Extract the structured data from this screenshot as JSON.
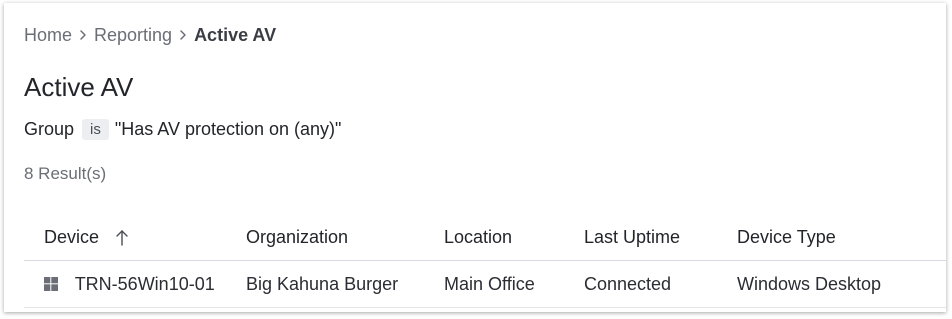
{
  "breadcrumb": {
    "items": [
      "Home",
      "Reporting"
    ],
    "current": "Active AV"
  },
  "page": {
    "title": "Active AV"
  },
  "filter": {
    "field": "Group",
    "operator": "is",
    "value": "\"Has AV protection on (any)\""
  },
  "results": {
    "count_label": "8 Result(s)"
  },
  "table": {
    "columns": [
      "Device",
      "Organization",
      "Location",
      "Last Uptime",
      "Device Type"
    ],
    "sorted_column": "Device",
    "sort_direction": "ascending",
    "rows": [
      {
        "icon": "windows-icon",
        "device": "TRN-56Win10-01",
        "organization": "Big Kahuna Burger",
        "location": "Main Office",
        "last_uptime": "Connected",
        "device_type": "Windows Desktop"
      }
    ]
  },
  "colors": {
    "text_primary": "#23252a",
    "text_muted": "#6b6e76",
    "chip_bg": "#eceef1",
    "divider": "#d9dbe0"
  }
}
